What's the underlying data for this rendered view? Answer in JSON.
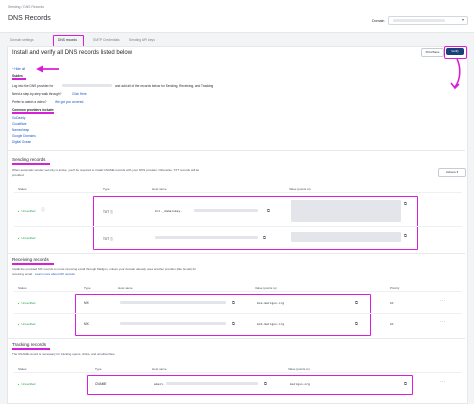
{
  "breadcrumb": "Sending  /  DNS Records",
  "page_title": "DNS Records",
  "domain_label": "Domain",
  "tabs": [
    "Domain settings",
    "DNS records",
    "SMTP Credentials",
    "Sending API keys"
  ],
  "main": {
    "heading": "Install and verify all DNS records listed below",
    "print_label": "Print/Save",
    "verify_label": "Verify",
    "hide_label": "^ Hide all",
    "guides_title": "Guides",
    "guides_line1": "Log into the DNS provider for",
    "guides_line1b": "and add all of the records below for Sending, Receiving, and Tracking",
    "guides_line2": "Need a step-by-step walk through?",
    "guides_line2_link": "Click Here",
    "guides_line3": "Prefer to watch a video?",
    "guides_line3_link": "We got you covered.",
    "common_title": "Common providers include:",
    "providers": [
      "GoDaddy",
      "Cloudflare",
      "Namecheap",
      "Google Domains",
      "Digital Ocean"
    ]
  },
  "sending": {
    "title": "Sending records",
    "desc1": "When  automatic sender security  is active, you'll be required to install CNAME records with your DNS provider. Otherwise, TXT records will be",
    "desc2": "provided.",
    "actions_label": "Actions  ▾",
    "headers": {
      "status": "Status",
      "type": "Type",
      "host": "Host name",
      "value": "Value (points to)"
    },
    "rows": [
      {
        "status": "Unverified",
        "type": "TXT ⓘ",
        "host": "k=i._domainkey."
      },
      {
        "status": "Unverified",
        "type": "TXT ⓘ",
        "host": ""
      }
    ]
  },
  "receiving": {
    "title": "Receiving records",
    "desc1": "Install the provided MX records to route incoming email through Mailgun, unless your domain already uses another provider (like Gmail) for",
    "desc2": "receiving email.",
    "desc2_link": "Learn more about MX records",
    "headers": {
      "status": "Status",
      "type": "Type",
      "host": "Host name",
      "value": "Value (points to)",
      "priority": "Priority"
    },
    "rows": [
      {
        "status": "Unverified",
        "type": "MX",
        "value": "mxa.mailgun.org",
        "priority": "10"
      },
      {
        "status": "Unverified",
        "type": "MX",
        "value": "mxb.mailgun.org",
        "priority": "10"
      }
    ]
  },
  "tracking": {
    "title": "Tracking records",
    "desc1": "The CNAME record is necessary for tracking opens, clicks, and unsubscribes.",
    "headers": {
      "status": "Status",
      "type": "Type",
      "host": "Host name",
      "value": "Value (points to)"
    },
    "rows": [
      {
        "status": "Unverified",
        "type": "CNAME",
        "host": "email.",
        "value": "mailgun.org"
      }
    ]
  },
  "colors": {
    "accent": "#d91ed9",
    "primary": "#19407a",
    "success": "#1f9e3f",
    "link": "#1a56c4"
  }
}
